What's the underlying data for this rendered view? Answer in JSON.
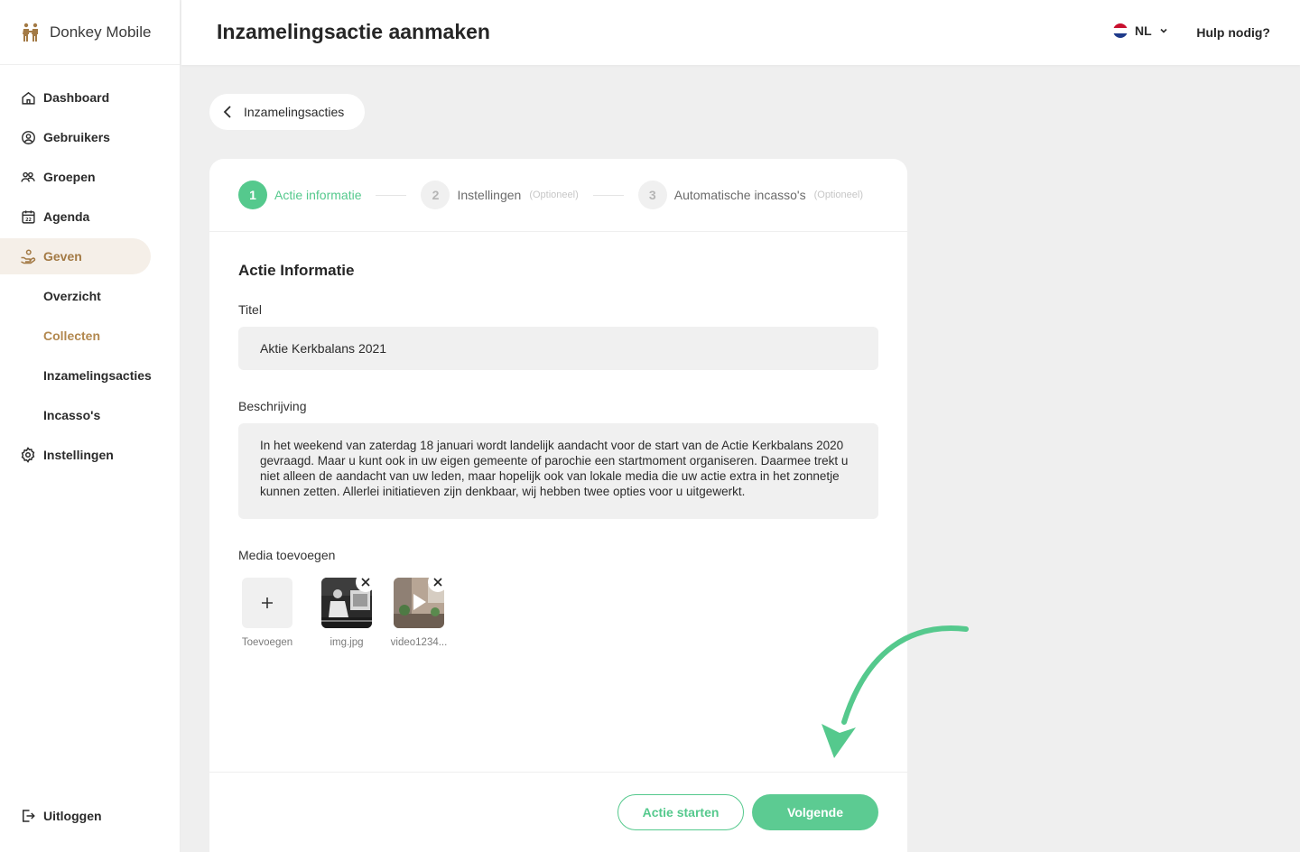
{
  "app": {
    "name": "Donkey Mobile"
  },
  "header": {
    "title": "Inzamelingsactie aanmaken",
    "language": "NL",
    "help": "Hulp nodig?"
  },
  "sidebar": {
    "items": [
      {
        "label": "Dashboard",
        "icon": "home-icon"
      },
      {
        "label": "Gebruikers",
        "icon": "user-circle-icon"
      },
      {
        "label": "Groepen",
        "icon": "group-icon"
      },
      {
        "label": "Agenda",
        "icon": "calendar-icon"
      },
      {
        "label": "Geven",
        "icon": "giving-hand-icon"
      },
      {
        "label": "Overzicht"
      },
      {
        "label": "Collecten"
      },
      {
        "label": "Inzamelingsacties"
      },
      {
        "label": "Incasso's"
      },
      {
        "label": "Instellingen",
        "icon": "gear-icon"
      }
    ],
    "logout": "Uitloggen"
  },
  "breadcrumb": {
    "back_label": "Inzamelingsacties"
  },
  "stepper": {
    "steps": [
      {
        "num": "1",
        "label": "Actie informatie",
        "optional": ""
      },
      {
        "num": "2",
        "label": "Instellingen",
        "optional": "(Optioneel)"
      },
      {
        "num": "3",
        "label": "Automatische incasso's",
        "optional": "(Optioneel)"
      }
    ]
  },
  "form": {
    "section_title": "Actie Informatie",
    "title_label": "Titel",
    "title_value": "Aktie Kerkbalans 2021",
    "desc_label": "Beschrijving",
    "desc_value": "In het weekend van zaterdag 18 januari wordt landelijk aandacht voor de start van de Actie Kerkbalans 2020 gevraagd. Maar u kunt ook in uw eigen gemeente of parochie een startmoment organiseren. Daarmee trekt u niet alleen de aandacht van uw leden, maar hopelijk ook van lokale media die uw actie extra in het zonnetje kunnen zetten. Allerlei initiatieven zijn denkbaar, wij hebben twee opties voor u uitgewerkt.",
    "media_label": "Media toevoegen",
    "media": {
      "add_label": "Toevoegen",
      "files": [
        "img.jpg",
        "video1234..."
      ]
    }
  },
  "footer": {
    "secondary_label": "Actie starten",
    "primary_label": "Volgende"
  },
  "colors": {
    "accent": "#55c98d",
    "brand": "#a37a45"
  }
}
